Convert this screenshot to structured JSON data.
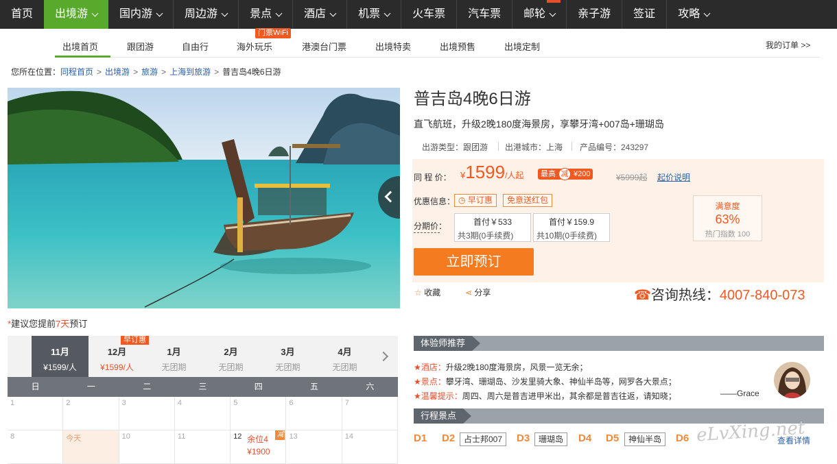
{
  "top_nav": [
    {
      "label": "首页",
      "chevron": false
    },
    {
      "label": "出境游",
      "chevron": true,
      "active": true
    },
    {
      "label": "国内游",
      "chevron": true
    },
    {
      "label": "周边游",
      "chevron": true
    },
    {
      "label": "景点",
      "chevron": true
    },
    {
      "label": "酒店",
      "chevron": true
    },
    {
      "label": "机票",
      "chevron": true
    },
    {
      "label": "火车票",
      "chevron": false
    },
    {
      "label": "汽车票",
      "chevron": false
    },
    {
      "label": "邮轮",
      "chevron": true
    },
    {
      "label": "亲子游",
      "chevron": false
    },
    {
      "label": "签证",
      "chevron": false
    },
    {
      "label": "攻略",
      "chevron": true
    }
  ],
  "sub_nav": {
    "items": [
      "出境首页",
      "跟团游",
      "自由行",
      "海外玩乐",
      "港澳台门票",
      "出境特卖",
      "出境预售",
      "出境定制"
    ],
    "badge": "门票WiFi",
    "my_order": "我的订单 >>"
  },
  "breadcrumb": {
    "prefix": "您所在位置：",
    "links": [
      "同程首页",
      "出境游",
      "旅游",
      "上海到旅游"
    ],
    "current": "普吉岛4晚6日游"
  },
  "advice": {
    "star": "*",
    "pre": "建议您提前",
    "days": "7天",
    "post": "预订"
  },
  "calendar": {
    "months": [
      {
        "m": "11月",
        "p": "¥1599/人"
      },
      {
        "m": "12月",
        "p": "¥1599/人"
      },
      {
        "m": "1月",
        "p": "无团期"
      },
      {
        "m": "2月",
        "p": "无团期"
      },
      {
        "m": "3月",
        "p": "无团期"
      },
      {
        "m": "4月",
        "p": "无团期"
      }
    ],
    "early_tag": "早订惠",
    "weekdays": [
      "日",
      "一",
      "二",
      "三",
      "四",
      "五",
      "六"
    ],
    "row1": [
      "1",
      "2",
      "3",
      "4",
      "5",
      "6",
      "7"
    ],
    "row2": [
      "8",
      "今天",
      "10",
      "11",
      "12",
      "13",
      "14"
    ],
    "sel_remain": "余位4",
    "sel_price": "¥1900",
    "sel_tag": "减"
  },
  "product": {
    "title": "普吉岛4晚6日游",
    "subtitle": "直飞航班，升级2晚180度海景房，享攀牙湾+007岛+珊瑚岛",
    "type": "出游类型：跟团游",
    "city": "出港城市：上海",
    "code": "产品编号：243297"
  },
  "price": {
    "label": "同 程 价：",
    "yen": "¥",
    "value": "1599",
    "unit": "/人起",
    "max_pre": "最高",
    "max_mid": "减",
    "max_post": "¥200",
    "old": "¥5999起",
    "explain": "起价说明"
  },
  "promo": {
    "label": "优惠信息：",
    "tags": [
      "早订惠",
      "免意送红包"
    ]
  },
  "installment": {
    "label": "分期价：",
    "options": [
      {
        "a": "首付￥533",
        "b": "共3期(0手续费)"
      },
      {
        "a": "首付￥159.9",
        "b": "共10期(0手续费)"
      }
    ]
  },
  "satisfaction": {
    "title": "满意度",
    "value": "63%",
    "hot": "热门指数 100"
  },
  "book_button": "立即预订",
  "actions": {
    "fav": "收藏",
    "share": "分享"
  },
  "hotline": {
    "label": "咨询热线：",
    "number": "4007-840-073"
  },
  "recommend": {
    "tab": "体验师推荐",
    "lines": [
      {
        "k": "酒店：",
        "v": "升级2晚180度海景房，风景一览无余；"
      },
      {
        "k": "景点：",
        "v": "攀牙湾、珊瑚岛、沙发里骑大象、神仙半岛等，网罗各大景点；"
      },
      {
        "k": "温馨提示：",
        "v": "周四、周六是普吉进甲米出，其余都是普吉往返，请知晓；"
      }
    ],
    "author": "——Grace"
  },
  "itinerary": {
    "tab": "行程景点",
    "days": [
      {
        "d": "D1",
        "s": ""
      },
      {
        "d": "D2",
        "s": "占士邦007"
      },
      {
        "d": "D3",
        "s": "珊瑚岛"
      },
      {
        "d": "D4",
        "s": ""
      },
      {
        "d": "D5",
        "s": "神仙半岛"
      },
      {
        "d": "D6",
        "s": ""
      }
    ],
    "detail": "查看详情"
  },
  "watermark": "eLvXing.net",
  "colors": {
    "accent_green": "#59a92d",
    "accent_orange": "#f05a22",
    "nav_bg": "#2b2b2b"
  }
}
